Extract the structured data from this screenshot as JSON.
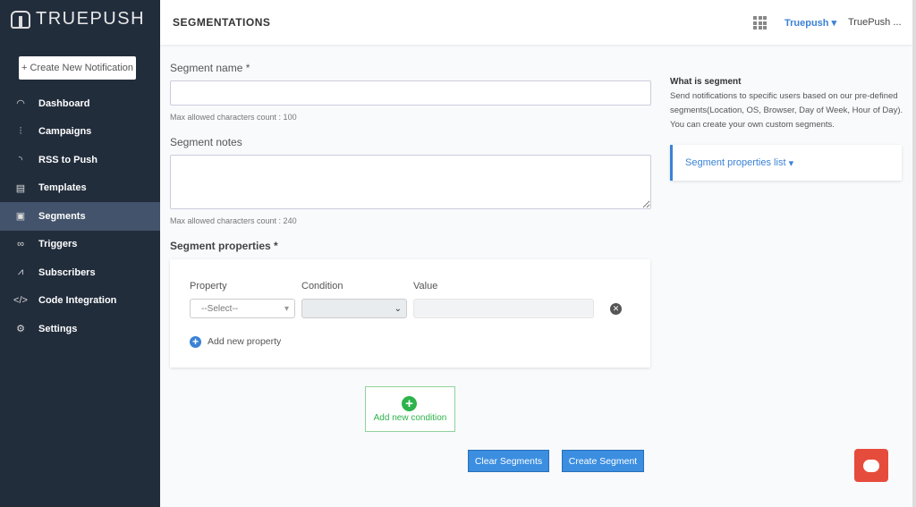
{
  "app": {
    "logo": "TRUEPUSH",
    "create_button": "+ Create New Notification"
  },
  "sidebar": {
    "items": [
      {
        "label": "Dashboard",
        "icon": "gauge-icon"
      },
      {
        "label": "Campaigns",
        "icon": "sliders-icon"
      },
      {
        "label": "RSS to Push",
        "icon": "rss-icon"
      },
      {
        "label": "Templates",
        "icon": "template-icon"
      },
      {
        "label": "Segments",
        "icon": "segments-icon",
        "active": true
      },
      {
        "label": "Triggers",
        "icon": "triggers-icon"
      },
      {
        "label": "Subscribers",
        "icon": "subscribers-icon"
      },
      {
        "label": "Code Integration",
        "icon": "code-icon"
      },
      {
        "label": "Settings",
        "icon": "gear-icon"
      }
    ]
  },
  "header": {
    "title": "SEGMENTATIONS",
    "brand": "Truepush",
    "user": "TruePush ..."
  },
  "form": {
    "name_label": "Segment name *",
    "name_value": "",
    "name_hint": "Max allowed characters count : 100",
    "notes_label": "Segment notes",
    "notes_value": "",
    "notes_hint": "Max allowed characters count : 240",
    "props_label": "Segment properties *",
    "property_header": "Property",
    "condition_header": "Condition",
    "value_header": "Value",
    "property_select": "--Select--",
    "add_property": "Add new property",
    "add_condition": "Add new condition",
    "clear": "Clear Segments",
    "create": "Create Segment"
  },
  "info": {
    "title": "What is segment",
    "text": "Send notifications to specific users based on our pre-defined segments(Location, OS, Browser, Day of Week, Hour of Day). You can create your own custom segments.",
    "list_link": "Segment properties list"
  },
  "colors": {
    "sidebar": "#222d3c",
    "accent": "#3b82d6",
    "green": "#2db34a",
    "chat": "#e64c3c"
  }
}
